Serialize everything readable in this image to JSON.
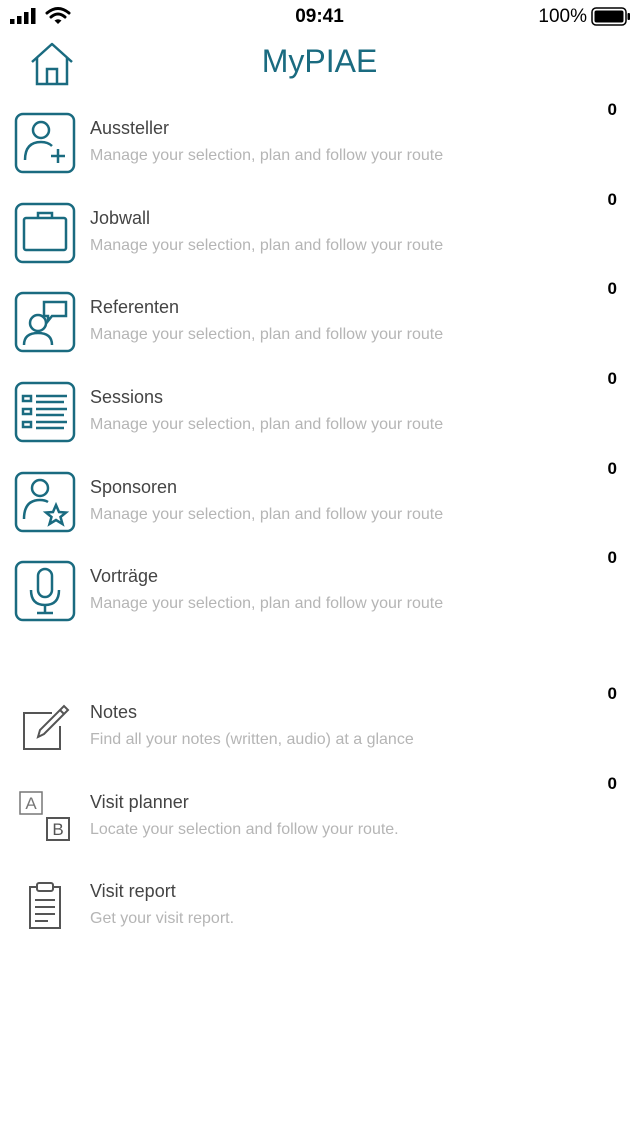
{
  "status_bar": {
    "time": "09:41",
    "battery": "100%"
  },
  "header": {
    "title": "MyPIAE"
  },
  "colors": {
    "accent": "#1a6b80",
    "subtitle": "#b5b5b5"
  },
  "items": [
    {
      "label": "Aussteller",
      "subtitle": "Manage your selection, plan and follow your route",
      "count": "0",
      "icon": "add-person-icon"
    },
    {
      "label": "Jobwall",
      "subtitle": "Manage your selection, plan and follow your route",
      "count": "0",
      "icon": "briefcase-icon"
    },
    {
      "label": "Referenten",
      "subtitle": "Manage your selection, plan and follow your route",
      "count": "0",
      "icon": "speaker-chat-icon"
    },
    {
      "label": "Sessions",
      "subtitle": "Manage your selection, plan and follow your route",
      "count": "0",
      "icon": "list-icon"
    },
    {
      "label": "Sponsoren",
      "subtitle": "Manage your selection, plan and follow your route",
      "count": "0",
      "icon": "star-person-icon"
    },
    {
      "label": "Vorträge",
      "subtitle": "Manage your selection, plan and follow your route",
      "count": "0",
      "icon": "microphone-icon"
    }
  ],
  "tools": [
    {
      "label": "Notes",
      "subtitle": "Find all your notes (written, audio) at a glance",
      "count": "0",
      "icon": "edit-note-icon"
    },
    {
      "label": "Visit planner",
      "subtitle": "Locate your selection and follow your route.",
      "count": "0",
      "icon": "a-b-route-icon"
    },
    {
      "label": "Visit report",
      "subtitle": "Get your visit report.",
      "icon": "clipboard-icon"
    }
  ]
}
